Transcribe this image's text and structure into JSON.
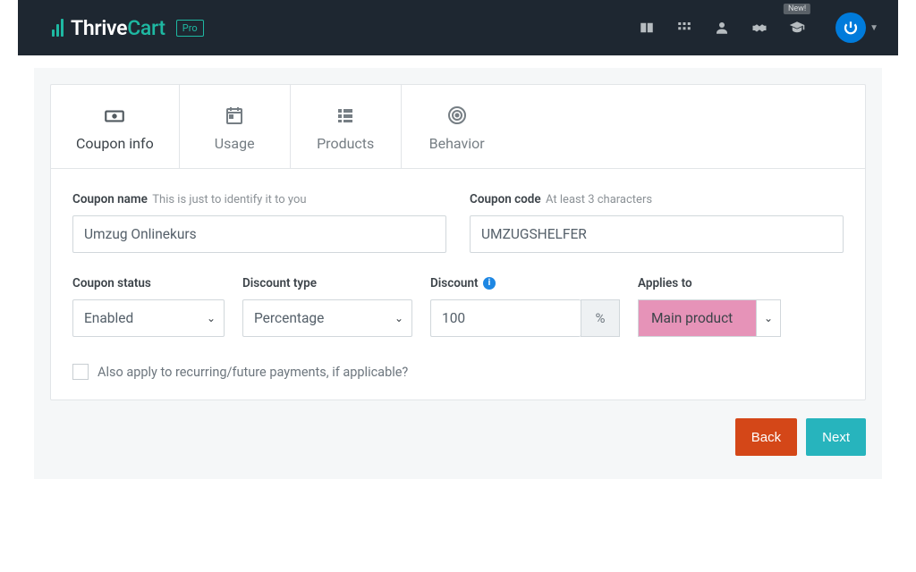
{
  "brand": {
    "name1": "Thrive",
    "name2": "Cart",
    "pro": "Pro",
    "new_badge": "New!"
  },
  "tabs": {
    "coupon_info": "Coupon info",
    "usage": "Usage",
    "products": "Products",
    "behavior": "Behavior"
  },
  "form": {
    "coupon_name_label": "Coupon name",
    "coupon_name_hint": "This is just to identify it to you",
    "coupon_name_value": "Umzug Onlinekurs",
    "coupon_code_label": "Coupon code",
    "coupon_code_hint": "At least 3 characters",
    "coupon_code_value": "UMZUGSHELFER",
    "status_label": "Coupon status",
    "status_value": "Enabled",
    "type_label": "Discount type",
    "type_value": "Percentage",
    "discount_label": "Discount",
    "discount_value": "100",
    "discount_unit": "%",
    "applies_label": "Applies to",
    "applies_value": "Main product",
    "recurring_label": "Also apply to recurring/future payments, if applicable?",
    "info_i": "i"
  },
  "buttons": {
    "back": "Back",
    "next": "Next"
  }
}
